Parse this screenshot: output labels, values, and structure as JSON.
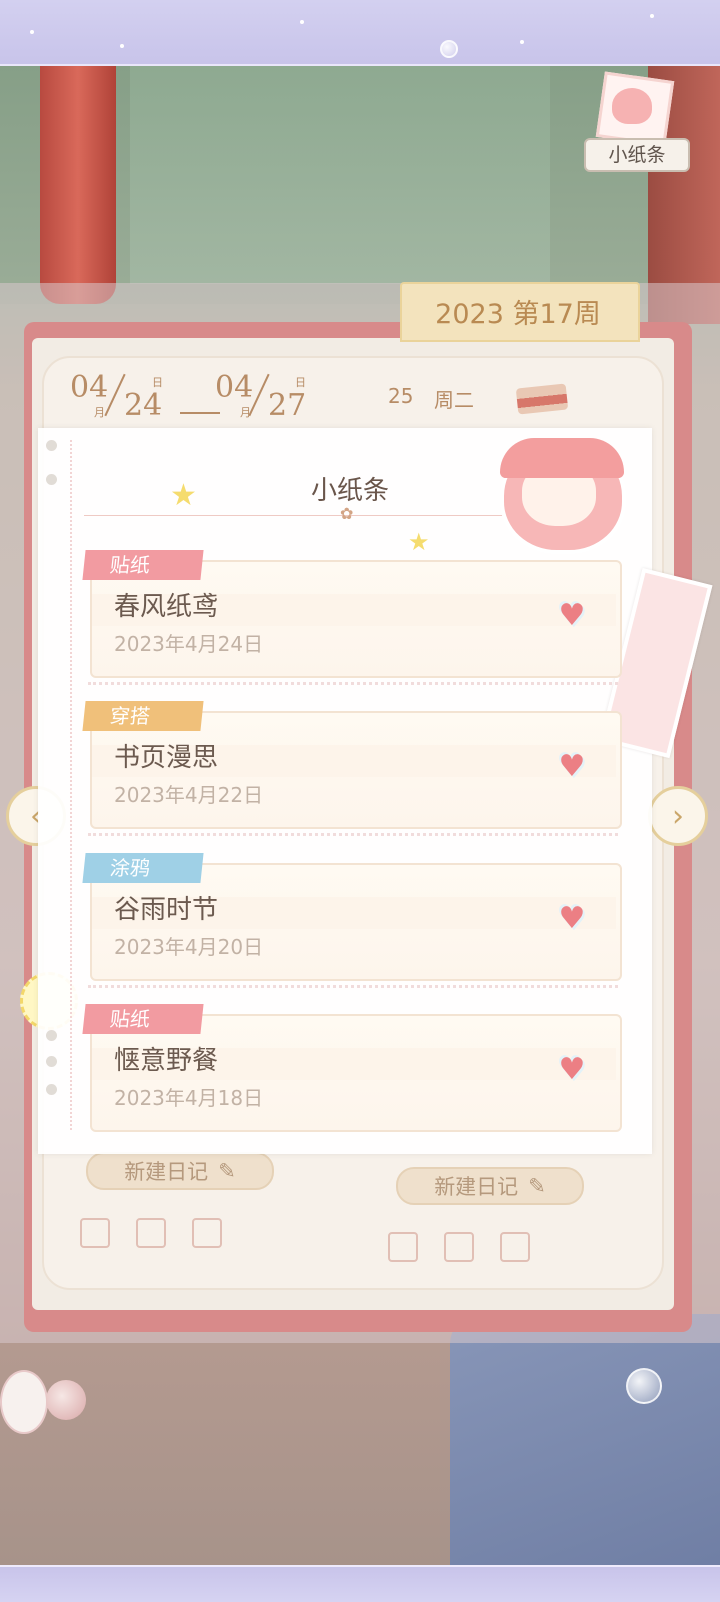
{
  "header": {
    "badge_label": "小纸条"
  },
  "week": {
    "label": "2023 第17周"
  },
  "date_range": {
    "start_month": "04",
    "start_day": "24",
    "end_month": "04",
    "end_day": "27",
    "month_unit": "月",
    "day_unit": "日"
  },
  "day_indicator": {
    "date": "25",
    "weekday": "周二"
  },
  "panel": {
    "title": "小纸条",
    "entries": [
      {
        "tag": "贴纸",
        "tag_color": "#f29ba1",
        "title": "春风纸鸢",
        "date": "2023年4月24日",
        "icon": "heart-arrow-icon"
      },
      {
        "tag": "穿搭",
        "tag_color": "#f0c07a",
        "title": "书页漫思",
        "date": "2023年4月22日",
        "icon": "heart-arrow-icon"
      },
      {
        "tag": "涂鸦",
        "tag_color": "#9fd0e6",
        "title": "谷雨时节",
        "date": "2023年4月20日",
        "icon": "heart-arrow-icon"
      },
      {
        "tag": "贴纸",
        "tag_color": "#f29ba1",
        "title": "惬意野餐",
        "date": "2023年4月18日",
        "icon": "heart-arrow-icon"
      }
    ]
  },
  "buttons": {
    "new_diary_left": "新建日记",
    "new_diary_right": "新建日记"
  },
  "nav": {
    "prev_icon": "chevron-left-icon",
    "next_icon": "chevron-right-icon"
  },
  "colors": {
    "accent_gold": "#b78c66",
    "notebook_pink": "#d88a8a",
    "lavender": "#cfcbe8"
  }
}
